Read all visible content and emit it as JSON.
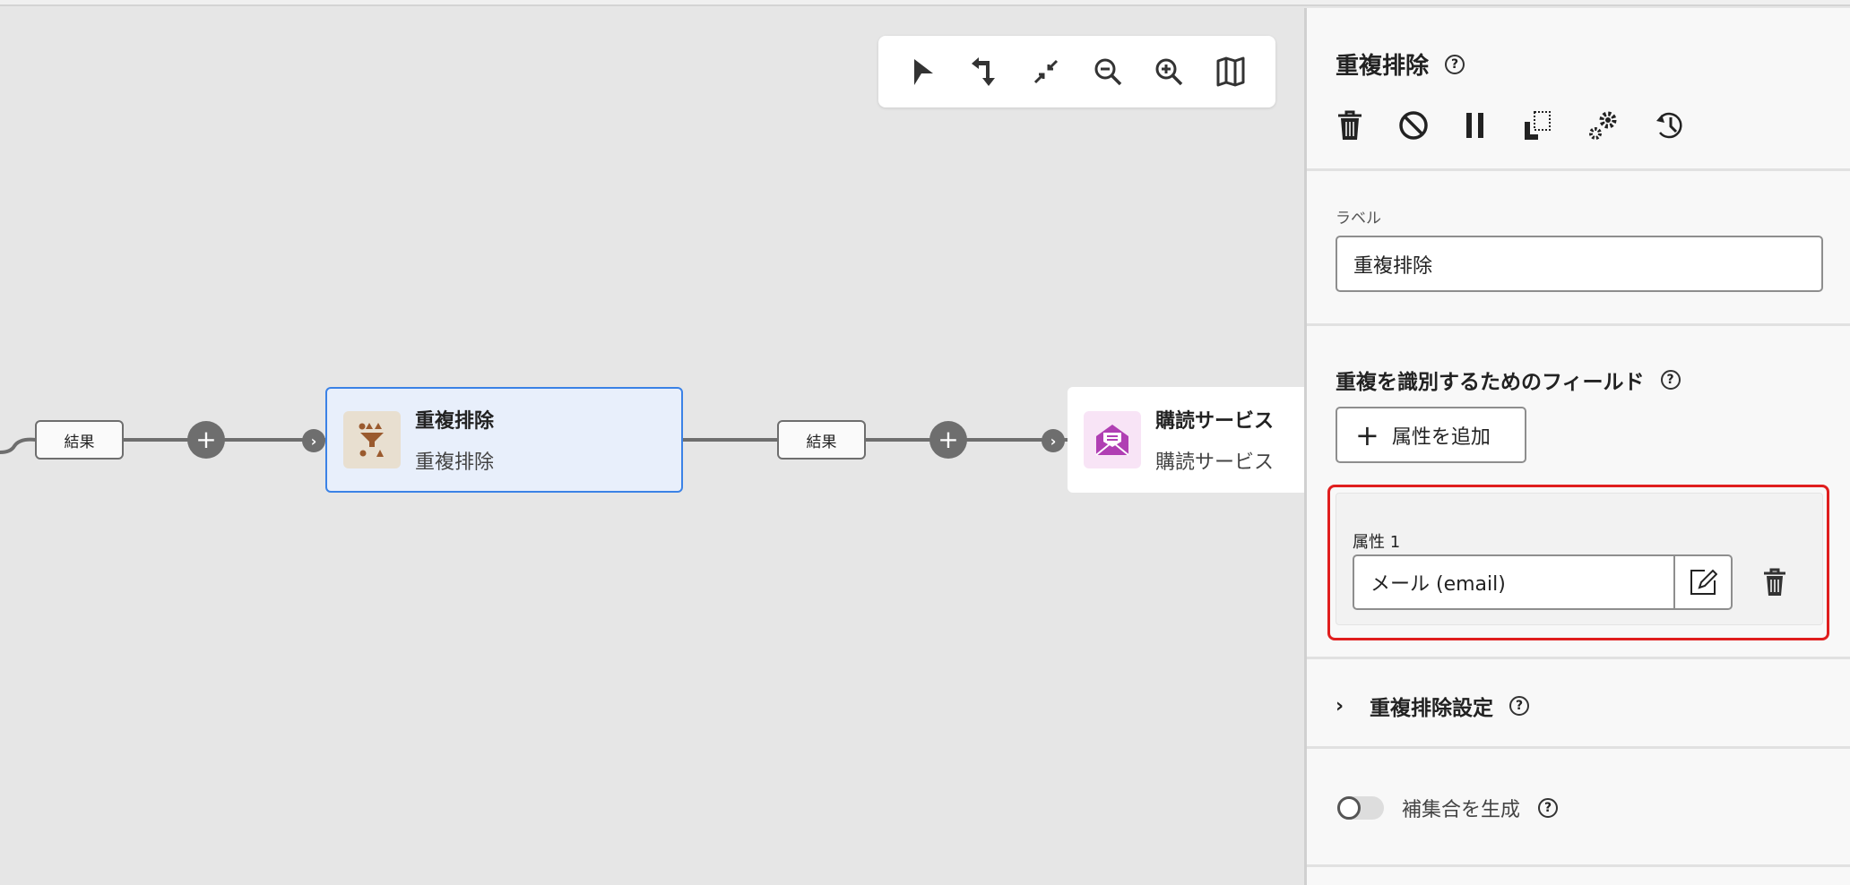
{
  "canvas": {
    "toolbar": [
      "select-pointer",
      "reorder",
      "collapse",
      "zoom-out",
      "zoom-in",
      "map"
    ],
    "connectors": [
      {
        "label": "結果"
      },
      {
        "label": "結果"
      }
    ],
    "nodes": [
      {
        "title": "重複排除",
        "subtitle": "重複排除",
        "icon": "deduplication-icon",
        "icon_bg": "#e8dfd0",
        "accent": "#9a5a2e",
        "selected": true
      },
      {
        "title": "購読サービス",
        "subtitle": "購読サービス",
        "icon": "envelope-icon",
        "icon_bg": "#f8e4f6",
        "accent": "#b03fb3"
      }
    ]
  },
  "panel": {
    "title": "重複排除",
    "actions": [
      "delete",
      "disable",
      "pause",
      "copy",
      "settings",
      "history"
    ],
    "label_field": {
      "label": "ラベル",
      "value": "重複排除"
    },
    "fields_section": {
      "title": "重複を識別するためのフィールド",
      "add_button": "属性を追加",
      "attributes": [
        {
          "label": "属性 1",
          "value": "メール (email)"
        }
      ]
    },
    "dedup_settings": {
      "title": "重複排除設定"
    },
    "complement": {
      "label": "補集合を生成",
      "enabled": false
    }
  },
  "colors": {
    "highlight": "#e01e1e",
    "selected_border": "#3b82e6",
    "selected_bg": "#e8effb"
  }
}
